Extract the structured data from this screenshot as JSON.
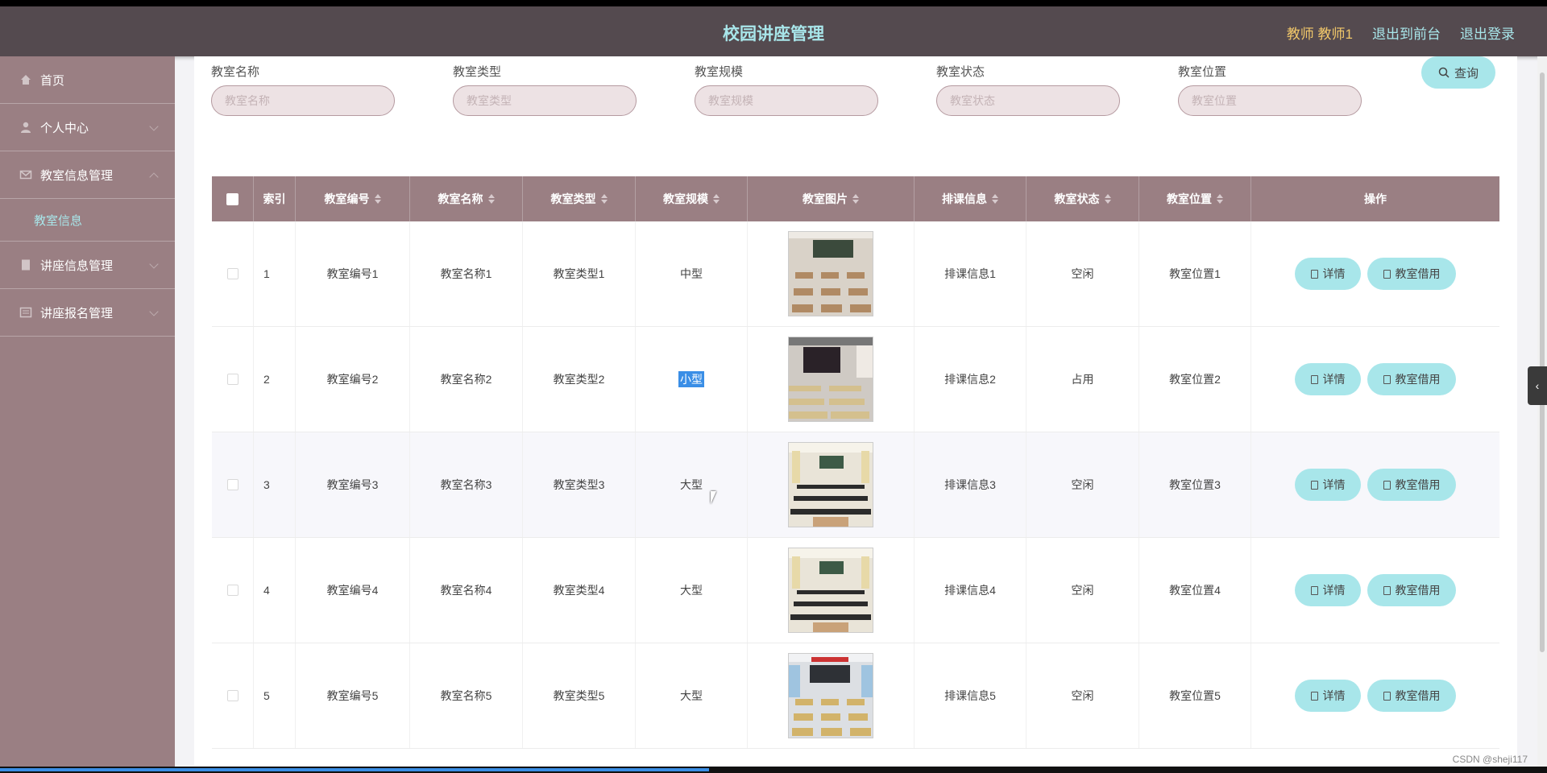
{
  "header": {
    "title": "校园讲座管理",
    "role_label": "教师 教师1",
    "link_front": "退出到前台",
    "link_logout": "退出登录"
  },
  "sidebar": {
    "items": [
      {
        "label": "首页",
        "icon": "home-icon"
      },
      {
        "label": "个人中心",
        "icon": "user-icon"
      },
      {
        "label": "教室信息管理",
        "icon": "mail-icon"
      },
      {
        "label": "讲座信息管理",
        "icon": "document-icon"
      },
      {
        "label": "讲座报名管理",
        "icon": "list-icon"
      }
    ],
    "sub_item": "教室信息"
  },
  "filters": {
    "name": {
      "label": "教室名称",
      "placeholder": "教室名称"
    },
    "type": {
      "label": "教室类型",
      "placeholder": "教室类型"
    },
    "scale": {
      "label": "教室规模",
      "placeholder": "教室规模"
    },
    "status": {
      "label": "教室状态",
      "placeholder": "教室状态"
    },
    "location": {
      "label": "教室位置",
      "placeholder": "教室位置"
    },
    "search_label": "查询"
  },
  "table": {
    "headers": {
      "index": "索引",
      "code": "教室编号",
      "name": "教室名称",
      "type": "教室类型",
      "scale": "教室规模",
      "image": "教室图片",
      "schedule": "排课信息",
      "status": "教室状态",
      "location": "教室位置",
      "ops": "操作"
    },
    "rows": [
      {
        "index": "1",
        "code": "教室编号1",
        "name": "教室名称1",
        "type": "教室类型1",
        "scale": "中型",
        "schedule": "排课信息1",
        "status": "空闲",
        "location": "教室位置1"
      },
      {
        "index": "2",
        "code": "教室编号2",
        "name": "教室名称2",
        "type": "教室类型2",
        "scale": "小型",
        "schedule": "排课信息2",
        "status": "占用",
        "location": "教室位置2"
      },
      {
        "index": "3",
        "code": "教室编号3",
        "name": "教室名称3",
        "type": "教室类型3",
        "scale": "大型",
        "schedule": "排课信息3",
        "status": "空闲",
        "location": "教室位置3"
      },
      {
        "index": "4",
        "code": "教室编号4",
        "name": "教室名称4",
        "type": "教室类型4",
        "scale": "大型",
        "schedule": "排课信息4",
        "status": "空闲",
        "location": "教室位置4"
      },
      {
        "index": "5",
        "code": "教室编号5",
        "name": "教室名称5",
        "type": "教室类型5",
        "scale": "大型",
        "schedule": "排课信息5",
        "status": "空闲",
        "location": "教室位置5"
      }
    ],
    "detail_label": "详情",
    "borrow_label": "教室借用"
  },
  "watermark": "CSDN @sheji117",
  "colors": {
    "header_bg": "#544a4f",
    "sidebar_bg": "#9a7f83",
    "accent": "#a8e6ea",
    "role_color": "#f2c86a"
  }
}
